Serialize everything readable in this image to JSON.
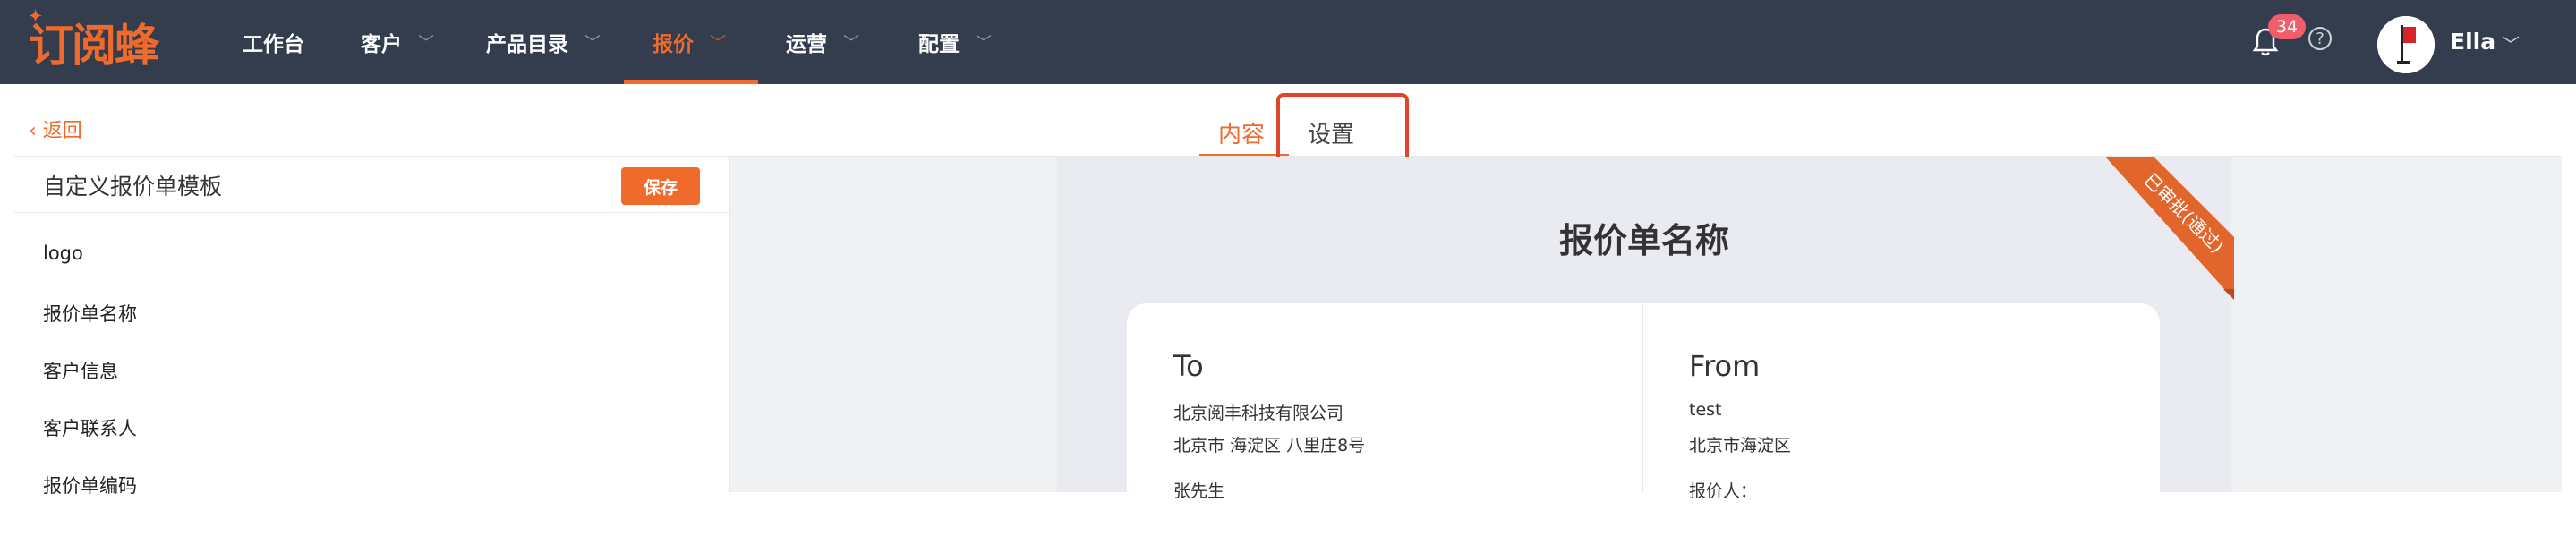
{
  "brand": {
    "logo_text": "订阅蜂"
  },
  "nav": {
    "items": [
      {
        "label": "工作台"
      },
      {
        "label": "客户"
      },
      {
        "label": "产品目录"
      },
      {
        "label": "报价"
      },
      {
        "label": "运营"
      },
      {
        "label": "配置"
      }
    ],
    "active": "报价",
    "notification_count": "34",
    "help_glyph": "?",
    "user_name": "Ella"
  },
  "subheader": {
    "back_label": "返回",
    "tabs": [
      {
        "label": "内容"
      },
      {
        "label": "设置"
      }
    ]
  },
  "left_panel": {
    "title": "自定义报价单模板",
    "save_label": "保存",
    "items": [
      "logo",
      "报价单名称",
      "客户信息",
      "客户联系人",
      "报价单编码"
    ]
  },
  "preview": {
    "title": "报价单名称",
    "ribbon_text": "已审批(通过)",
    "to": {
      "heading": "To",
      "company": "北京阅丰科技有限公司",
      "address": "北京市 海淀区 八里庄8号",
      "contact": "张先生"
    },
    "from": {
      "heading": "From",
      "company": "test",
      "address": "北京市海淀区",
      "quoter": "报价人："
    }
  },
  "colors": {
    "accent": "#ef6a2b",
    "nav_bg": "#333d4d",
    "badge": "#f05e6a",
    "highlight": "#e0452a"
  }
}
